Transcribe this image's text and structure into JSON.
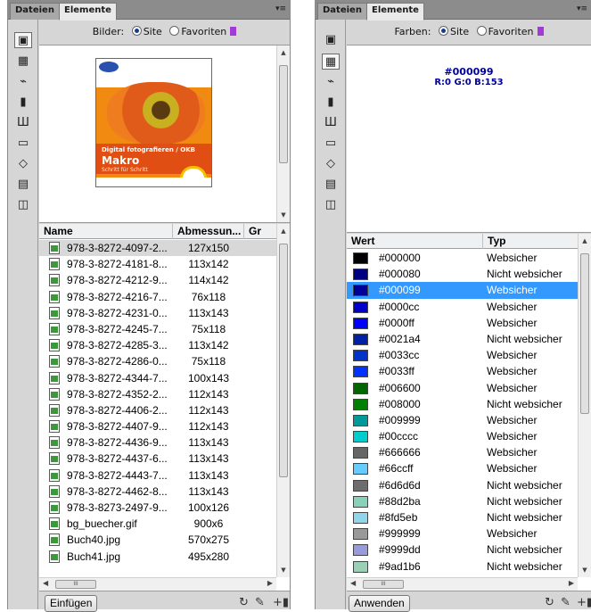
{
  "left_panel": {
    "tabs": [
      "Dateien",
      "Elemente"
    ],
    "radio_label": "Bilder:",
    "radio_site": "Site",
    "radio_favorites": "Favoriten",
    "preview": {
      "cover_line1": "Digital fotografieren / OKB",
      "cover_title": "Makro",
      "cover_line3": "Schritt für Schritt"
    },
    "columns": [
      "Name",
      "Abmessun...",
      "Gr"
    ],
    "rows": [
      {
        "name": "978-3-8272-4097-2...",
        "dim": "127x150"
      },
      {
        "name": "978-3-8272-4181-8...",
        "dim": "113x142"
      },
      {
        "name": "978-3-8272-4212-9...",
        "dim": "114x142"
      },
      {
        "name": "978-3-8272-4216-7...",
        "dim": "76x118"
      },
      {
        "name": "978-3-8272-4231-0...",
        "dim": "113x143"
      },
      {
        "name": "978-3-8272-4245-7...",
        "dim": "75x118"
      },
      {
        "name": "978-3-8272-4285-3...",
        "dim": "113x142"
      },
      {
        "name": "978-3-8272-4286-0...",
        "dim": "75x118"
      },
      {
        "name": "978-3-8272-4344-7...",
        "dim": "100x143"
      },
      {
        "name": "978-3-8272-4352-2...",
        "dim": "112x143"
      },
      {
        "name": "978-3-8272-4406-2...",
        "dim": "112x143"
      },
      {
        "name": "978-3-8272-4407-9...",
        "dim": "112x143"
      },
      {
        "name": "978-3-8272-4436-9...",
        "dim": "113x143"
      },
      {
        "name": "978-3-8272-4437-6...",
        "dim": "113x143"
      },
      {
        "name": "978-3-8272-4443-7...",
        "dim": "113x143"
      },
      {
        "name": "978-3-8272-4462-8...",
        "dim": "113x143"
      },
      {
        "name": "978-3-8273-2497-9...",
        "dim": "100x126"
      },
      {
        "name": "bg_buecher.gif",
        "dim": "900x6"
      },
      {
        "name": "Buch40.jpg",
        "dim": "570x275"
      },
      {
        "name": "Buch41.jpg",
        "dim": "495x280"
      }
    ],
    "scroll_grip": "III",
    "insert_button": "Einfügen"
  },
  "right_panel": {
    "tabs": [
      "Dateien",
      "Elemente"
    ],
    "radio_label": "Farben:",
    "radio_site": "Site",
    "radio_favorites": "Favoriten",
    "preview_hex": "#000099",
    "preview_rgb": "R:0 G:0 B:153",
    "columns": [
      "Wert",
      "Typ"
    ],
    "rows": [
      {
        "value": "#000000",
        "type": "Websicher",
        "color": "#000000"
      },
      {
        "value": "#000080",
        "type": "Nicht websicher",
        "color": "#000080"
      },
      {
        "value": "#000099",
        "type": "Websicher",
        "color": "#000099"
      },
      {
        "value": "#0000cc",
        "type": "Websicher",
        "color": "#0000cc"
      },
      {
        "value": "#0000ff",
        "type": "Websicher",
        "color": "#0000ff"
      },
      {
        "value": "#0021a4",
        "type": "Nicht websicher",
        "color": "#0021a4"
      },
      {
        "value": "#0033cc",
        "type": "Websicher",
        "color": "#0033cc"
      },
      {
        "value": "#0033ff",
        "type": "Websicher",
        "color": "#0033ff"
      },
      {
        "value": "#006600",
        "type": "Websicher",
        "color": "#006600"
      },
      {
        "value": "#008000",
        "type": "Nicht websicher",
        "color": "#008000"
      },
      {
        "value": "#009999",
        "type": "Websicher",
        "color": "#009999"
      },
      {
        "value": "#00cccc",
        "type": "Websicher",
        "color": "#00cccc"
      },
      {
        "value": "#666666",
        "type": "Websicher",
        "color": "#666666"
      },
      {
        "value": "#66ccff",
        "type": "Websicher",
        "color": "#66ccff"
      },
      {
        "value": "#6d6d6d",
        "type": "Nicht websicher",
        "color": "#6d6d6d"
      },
      {
        "value": "#88d2ba",
        "type": "Nicht websicher",
        "color": "#88d2ba"
      },
      {
        "value": "#8fd5eb",
        "type": "Nicht websicher",
        "color": "#8fd5eb"
      },
      {
        "value": "#999999",
        "type": "Websicher",
        "color": "#999999"
      },
      {
        "value": "#9999dd",
        "type": "Nicht websicher",
        "color": "#9999dd"
      },
      {
        "value": "#9ad1b6",
        "type": "Nicht websicher",
        "color": "#9ad1b6"
      }
    ],
    "scroll_grip": "III",
    "apply_button": "Anwenden"
  },
  "icons": {
    "sidebar": [
      "images-icon",
      "colors-icon",
      "urls-icon",
      "flash-icon",
      "shockwave-icon",
      "movies-icon",
      "scripts-icon",
      "templates-icon",
      "library-icon"
    ],
    "footer": [
      "refresh-icon",
      "edit-icon",
      "add-to-favorites-icon"
    ]
  },
  "colors": {
    "selection": "#3399ff",
    "panel_bg": "#d6d6d6",
    "tab_bar": "#8c8c8c",
    "accent_text": "#000099"
  }
}
